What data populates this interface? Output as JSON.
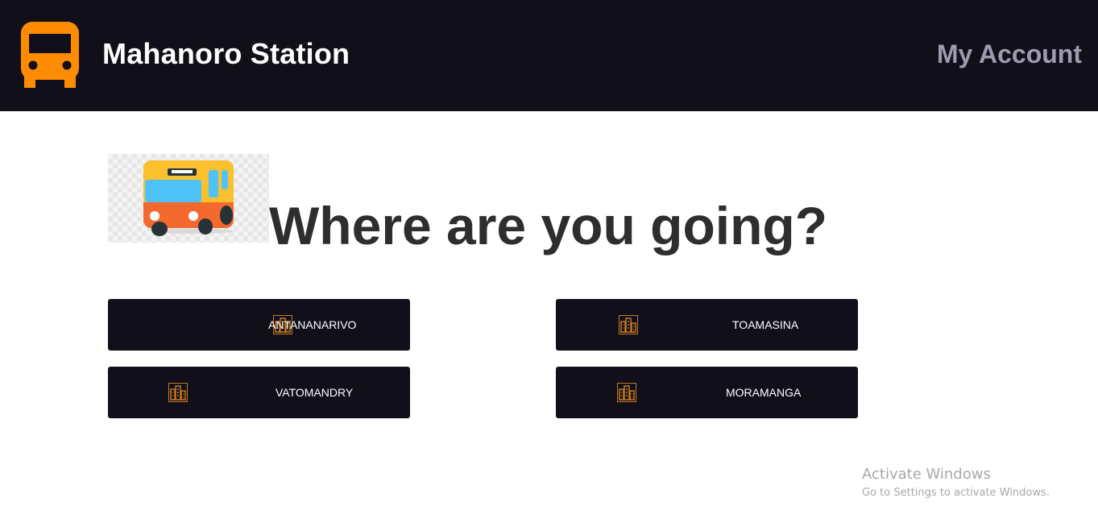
{
  "header": {
    "title": "Mahanoro Station",
    "account_label": "My Account",
    "logo_icon": "bus-icon",
    "accent_color": "#ff8c00"
  },
  "main": {
    "hero_icon": "bus-illustration",
    "heading": "Where are you going?",
    "destinations": [
      {
        "label": "ANTANANARIVO",
        "icon": "city-buildings-icon"
      },
      {
        "label": "TOAMASINA",
        "icon": "city-buildings-icon"
      },
      {
        "label": "VATOMANDRY",
        "icon": "city-buildings-icon"
      },
      {
        "label": "MORAMANGA",
        "icon": "city-buildings-icon"
      }
    ]
  },
  "watermark": {
    "title": "Activate Windows",
    "subtitle": "Go to Settings to activate Windows."
  }
}
